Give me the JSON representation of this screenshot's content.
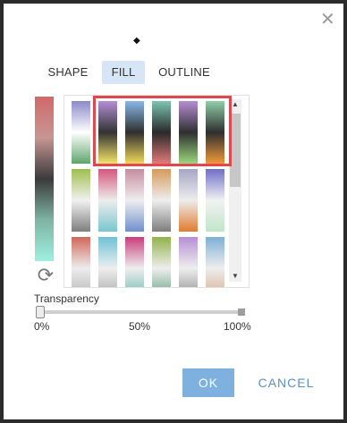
{
  "dialog": {
    "close_icon": "close-icon",
    "preview_icon": "diamond-icon"
  },
  "tabs": [
    {
      "label": "SHAPE",
      "active": false
    },
    {
      "label": "FILL",
      "active": true
    },
    {
      "label": "OUTLINE",
      "active": false
    }
  ],
  "colors": {
    "accent": "#7fb1e0",
    "highlight": "#e0474f",
    "active_tab": "#d7e6f7"
  },
  "gradients": [
    [
      "#8b89c9",
      "#ffffff",
      "#5fa46c"
    ],
    [
      "#b58ed6",
      "#333333",
      "#f5e46a"
    ],
    [
      "#88b8e8",
      "#2f2f2f",
      "#f1d85c"
    ],
    [
      "#7cc4b0",
      "#2a2a2a",
      "#e27a7a"
    ],
    [
      "#b68ed6",
      "#2f2f2f",
      "#9ad77e"
    ],
    [
      "#8fcfa9",
      "#2f2f2f",
      "#f09a3a"
    ],
    [
      "#9fbf4a",
      "#f1f1f1",
      "#7e7e7e"
    ],
    [
      "#d6557c",
      "#ededed",
      "#79c7cf"
    ],
    [
      "#c68ca0",
      "#eeeeee",
      "#6f8fcf"
    ],
    [
      "#d69a5a",
      "#eeeeee",
      "#7d7d7d"
    ],
    [
      "#a6a6c6",
      "#ededed",
      "#e17b2f"
    ],
    [
      "#6e6ec6",
      "#f2f2f2",
      "#bfe6c9"
    ],
    [
      "#d2665a",
      "#ededed",
      "#b3b3b3"
    ],
    [
      "#6ec2d6",
      "#eeeeee",
      "#a7a7a7"
    ],
    [
      "#c93d7a",
      "#eeeeee",
      "#6cb7b0"
    ],
    [
      "#93b24a",
      "#eeeeee",
      "#5d9f7e"
    ],
    [
      "#b88ed6",
      "#eeeeee",
      "#8b8b8b"
    ],
    [
      "#7db0d6",
      "#eeeeee",
      "#d6a98a"
    ]
  ],
  "refresh_icon": "refresh-icon",
  "scroll_up_icon": "scroll-up-icon",
  "scroll_down_icon": "scroll-down-icon",
  "transparency": {
    "label": "Transparency",
    "value": 0,
    "ticks": [
      "0%",
      "50%",
      "100%"
    ]
  },
  "buttons": {
    "ok": "OK",
    "cancel": "CANCEL"
  }
}
